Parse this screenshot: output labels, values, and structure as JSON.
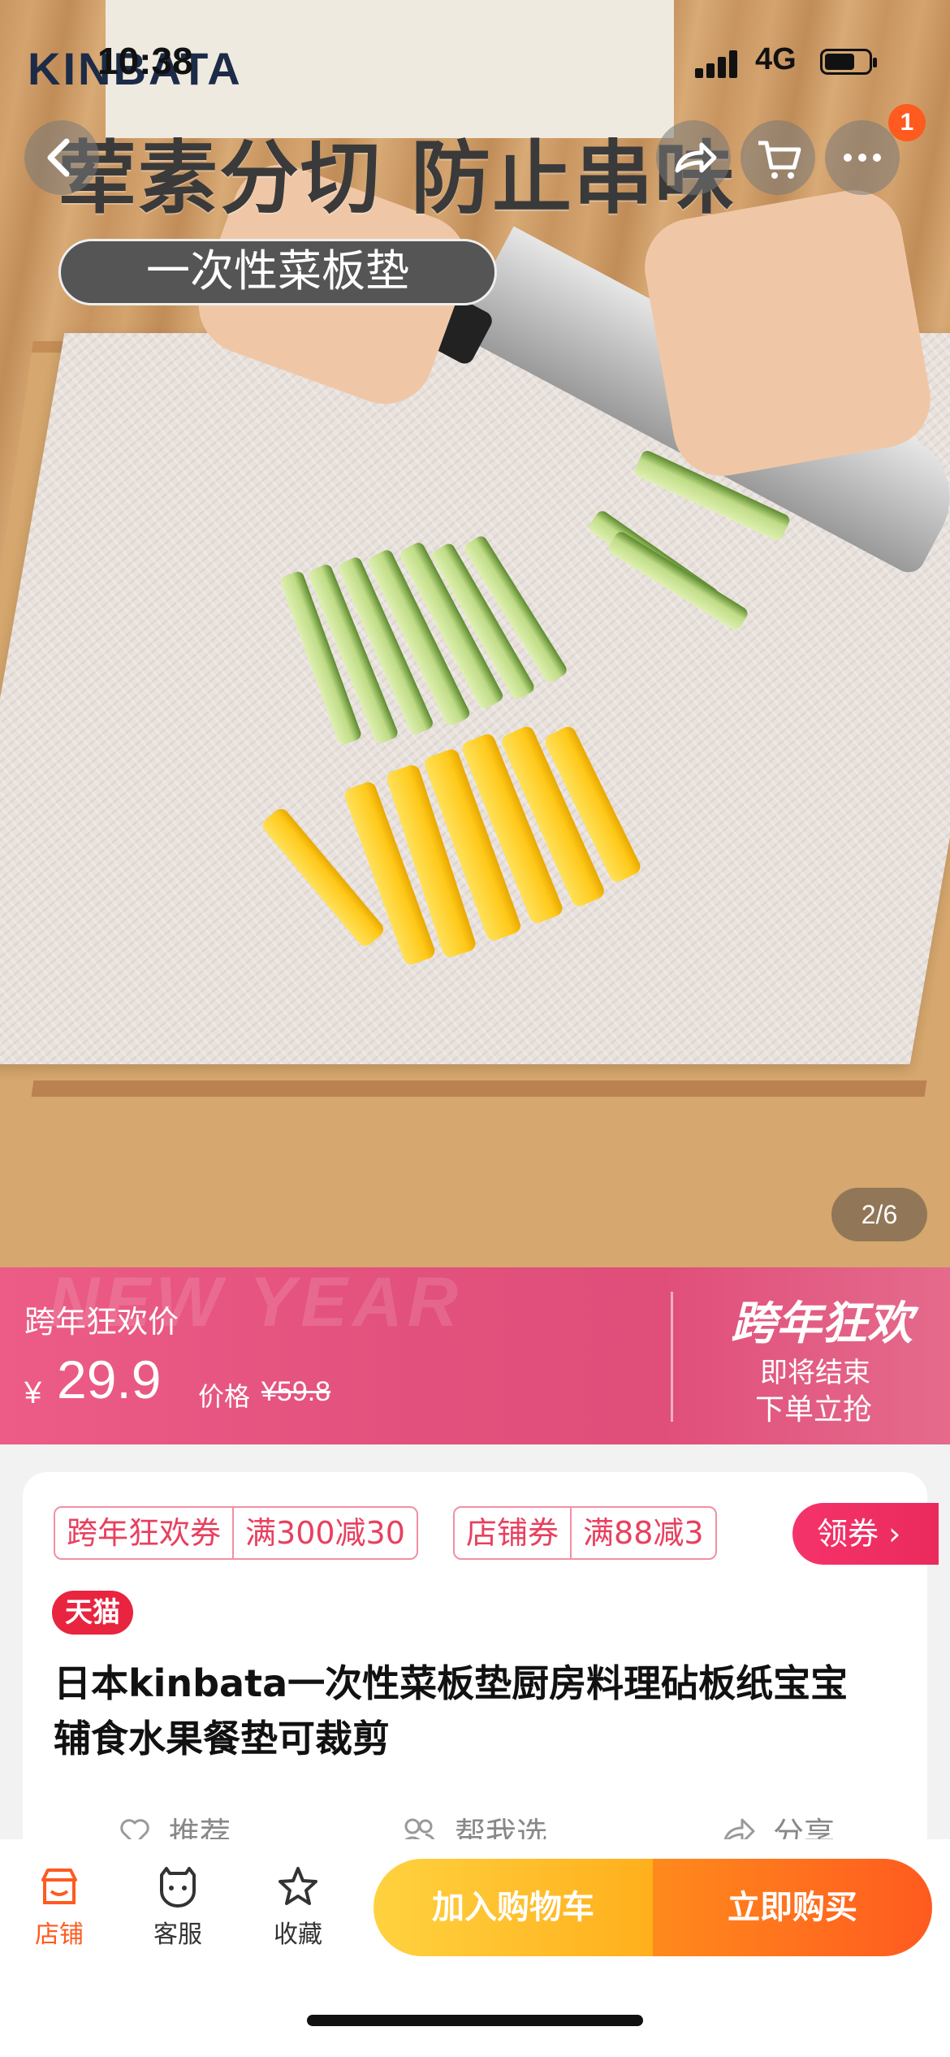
{
  "status_bar": {
    "time": "10:38",
    "network": "4G"
  },
  "hero": {
    "brand": "KINBATA",
    "headline": "荤素分切 防止串味",
    "subline": "一次性菜板垫",
    "image_counter": "2/6",
    "cart_badge": "1"
  },
  "price_banner": {
    "promo_label": "跨年狂欢价",
    "currency": "¥",
    "price": "29.9",
    "original_label": "价格",
    "original_price": "¥59.8",
    "background_text": "NEW YEAR",
    "festival_title": "跨年狂欢",
    "festival_sub1": "即将结束",
    "festival_sub2": "下单立抢"
  },
  "coupons": [
    {
      "name": "跨年狂欢券",
      "value": "满300减30"
    },
    {
      "name": "店铺券",
      "value": "满88减3"
    }
  ],
  "claim_button": "领券 ›",
  "product": {
    "platform_tag": "天猫",
    "title_line1": "日本kinbata一次性菜板垫厨房料理砧板纸宝宝",
    "title_line2": "辅食水果餐垫可裁剪"
  },
  "actions": [
    {
      "label": "推荐",
      "icon": "heart-icon"
    },
    {
      "label": "帮我选",
      "icon": "people-icon"
    },
    {
      "label": "分享",
      "icon": "share-icon"
    }
  ],
  "bottom_bar": {
    "tabs": [
      {
        "label": "店铺",
        "icon": "store-icon"
      },
      {
        "label": "客服",
        "icon": "service-icon"
      },
      {
        "label": "收藏",
        "icon": "star-icon"
      }
    ],
    "add_to_cart": "加入购物车",
    "buy_now": "立即购买"
  },
  "colors": {
    "accent": "#ff5a1f",
    "promo_pink": "#e2507d",
    "coupon_red": "#e8405f"
  }
}
